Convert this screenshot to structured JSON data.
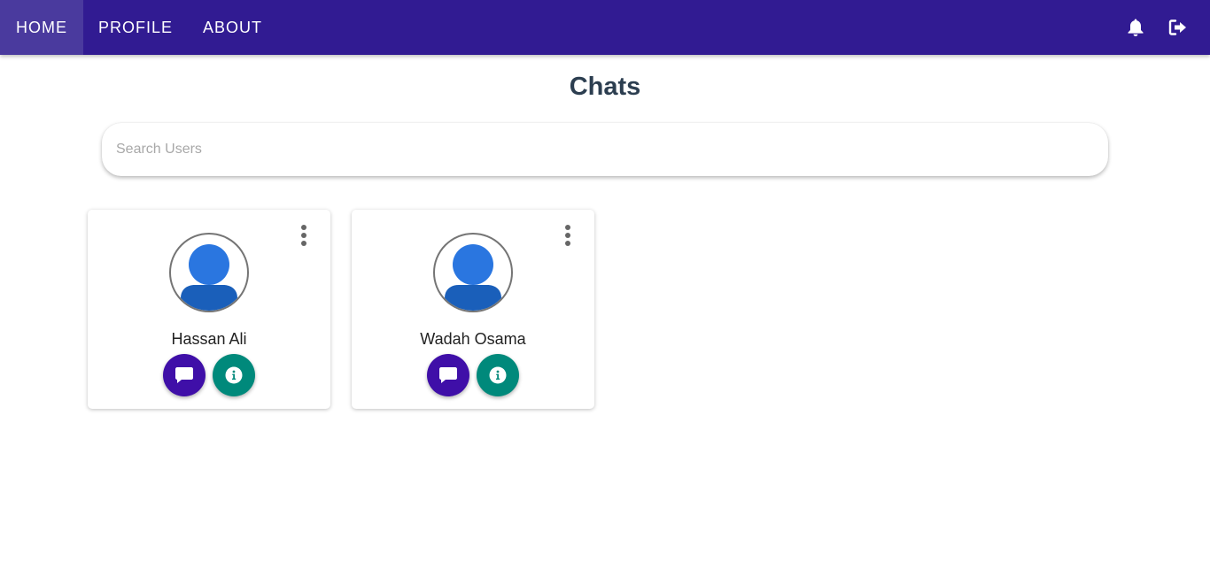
{
  "nav": {
    "items": [
      {
        "label": "HOME",
        "active": true
      },
      {
        "label": "PROFILE",
        "active": false
      },
      {
        "label": "ABOUT",
        "active": false
      }
    ],
    "right_icons": [
      "bell-icon",
      "sign-out-icon"
    ]
  },
  "page": {
    "title": "Chats"
  },
  "search": {
    "placeholder": "Search Users",
    "value": ""
  },
  "users": [
    {
      "name": "Hassan Ali",
      "avatar_icon": "user-avatar-icon"
    },
    {
      "name": "Wadah Osama",
      "avatar_icon": "user-avatar-icon"
    }
  ],
  "card_actions": {
    "chat_icon": "chat-bubble-icon",
    "info_icon": "info-icon",
    "menu_icon": "more-vertical-icon"
  },
  "colors": {
    "navbar": "#311b92",
    "nav_active": "#4a3a9e",
    "title": "#2c3e50",
    "chat_button": "#3f0fa8",
    "info_button": "#00897b",
    "avatar_head": "#2a76e0",
    "avatar_body": "#1a5fba"
  }
}
